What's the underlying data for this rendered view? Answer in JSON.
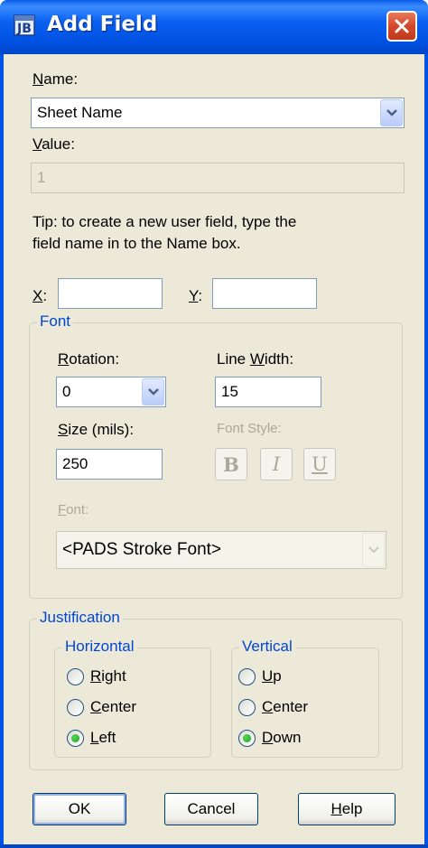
{
  "window": {
    "title": "Add Field",
    "icon": "pads-field-icon",
    "close_icon": "close-icon"
  },
  "name": {
    "label_prefix": "",
    "label_key": "N",
    "label_rest": "ame:",
    "value": "Sheet Name"
  },
  "value": {
    "label_key": "V",
    "label_rest": "alue:",
    "value": "1"
  },
  "tip": {
    "line1": "Tip: to create a new user field, type the",
    "line2": "field name in to the Name box."
  },
  "coords": {
    "x_key": "X",
    "x_rest": ":",
    "x_value": "",
    "y_key": "Y",
    "y_rest": ":",
    "y_value": ""
  },
  "font_group": {
    "legend": "Font",
    "rotation_key": "R",
    "rotation_rest": "otation:",
    "rotation_value": "0",
    "line_width_pre": "Line ",
    "line_width_key": "W",
    "line_width_rest": "idth:",
    "line_width_value": "15",
    "size_key": "S",
    "size_rest": "ize (mils):",
    "size_value": "250",
    "font_style_label": "Font Style:",
    "bold": "B",
    "italic": "I",
    "underline": "U",
    "font_key": "F",
    "font_rest": "ont:",
    "font_value": "<PADS Stroke Font>"
  },
  "justification": {
    "legend": "Justification",
    "horizontal": {
      "legend": "Horizontal",
      "options": [
        {
          "key": "R",
          "rest": "ight",
          "checked": false
        },
        {
          "key": "C",
          "rest": "enter",
          "checked": false
        },
        {
          "key": "L",
          "rest": "eft",
          "checked": true
        }
      ]
    },
    "vertical": {
      "legend": "Vertical",
      "options": [
        {
          "key": "U",
          "rest": "p",
          "checked": false
        },
        {
          "key": "C",
          "rest": "enter",
          "checked": false
        },
        {
          "key": "D",
          "rest": "own",
          "checked": true
        }
      ]
    }
  },
  "buttons": {
    "ok": "OK",
    "cancel": "Cancel",
    "help_key": "H",
    "help_rest": "elp"
  },
  "colors": {
    "title_bar": "#0054e3",
    "dialog_bg": "#ece9d8",
    "group_legend": "#0046d5",
    "disabled_text": "#aca899"
  }
}
